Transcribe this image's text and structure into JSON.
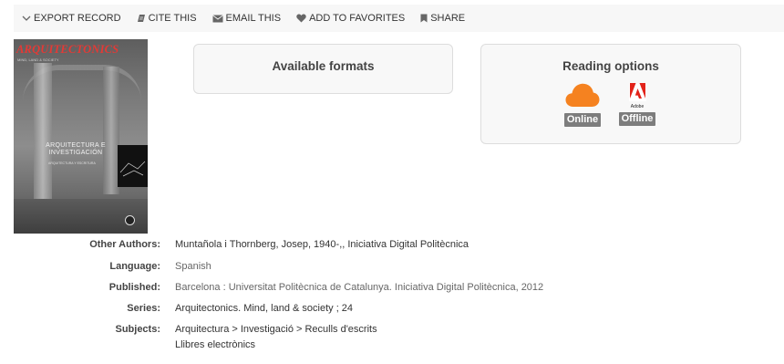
{
  "toolbar": {
    "export_label": "EXPORT RECORD",
    "cite_label": "CITE THIS",
    "email_label": "EMAIL THIS",
    "favorites_label": "ADD TO FAVORITES",
    "share_label": "SHARE"
  },
  "cover": {
    "title": "ARQUITECTONICS",
    "subtitle": "MIND, LAND & SOCIETY",
    "middle_text": "ARQUITECTURA E INVESTIGACIÓN",
    "middle_subtext": "ARQUITECTURA Y ESCRITURA"
  },
  "formats": {
    "title": "Available formats"
  },
  "reading": {
    "title": "Reading options",
    "online_label": "Online",
    "offline_label": "Offline",
    "adobe_caption": "Adobe",
    "cloud_color": "#f58220",
    "adobe_color": "#e2231a"
  },
  "details": {
    "other_authors": {
      "label": "Other Authors:",
      "value": "Muntañola i Thornberg, Josep, 1940-,, Iniciativa Digital Politècnica"
    },
    "language": {
      "label": "Language:",
      "value": "Spanish"
    },
    "published": {
      "label": "Published:",
      "value": "Barcelona : Universitat Politècnica de Catalunya. Iniciativa Digital Politècnica, 2012"
    },
    "series": {
      "label": "Series:",
      "value": "Arquitectonics. Mind, land & society ; 24"
    },
    "subjects": {
      "label": "Subjects:",
      "lines": [
        "Arquitectura > Investigació > Reculls d'escrits",
        "Llibres electrònics"
      ]
    }
  }
}
